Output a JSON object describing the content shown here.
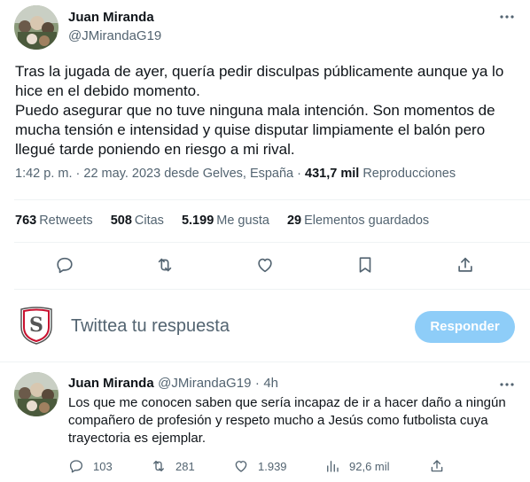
{
  "tweet": {
    "author_name": "Juan Miranda",
    "author_handle": "@JMirandaG19",
    "more_icon": "more-dots-icon",
    "text": "Tras la jugada de ayer, quería pedir disculpas públicamente aunque ya lo hice en el debido momento.\nPuedo asegurar que no tuve ninguna mala intención. Son momentos de mucha tensión e intensidad y quise disputar limpiamente el balón pero llegué tarde poniendo en riesgo a mi rival.",
    "time": "1:42 p. m.",
    "date": "22 may. 2023",
    "location": "desde Gelves, España",
    "separator": "·",
    "views_count": "431,7 mil",
    "views_label": "Reproducciones"
  },
  "stats": {
    "retweets_count": "763",
    "retweets_label": "Retweets",
    "quotes_count": "508",
    "quotes_label": "Citas",
    "likes_count": "5.199",
    "likes_label": "Me gusta",
    "bookmarks_count": "29",
    "bookmarks_label": "Elementos guardados"
  },
  "actions": [
    "reply-icon",
    "retweet-icon",
    "like-icon",
    "bookmark-icon",
    "share-icon"
  ],
  "composer": {
    "placeholder": "Twittea tu respuesta",
    "button_label": "Responder",
    "button_color": "#8ecdf8"
  },
  "reply": {
    "author_name": "Juan Miranda",
    "author_handle": "@JMirandaG19",
    "time_ago": "4h",
    "separator": "·",
    "text": "Los que me conocen saben que sería  incapaz de ir a hacer daño a ningún compañero de profesión y respeto mucho a Jesús como futbolista cuya trayectoria es ejemplar.",
    "replies": "103",
    "retweets": "281",
    "likes": "1.939",
    "views": "92,6 mil"
  },
  "colors": {
    "text": "#0f1419",
    "secondary": "#536471",
    "divider": "#eff3f4",
    "accent": "#1d9bf0"
  }
}
